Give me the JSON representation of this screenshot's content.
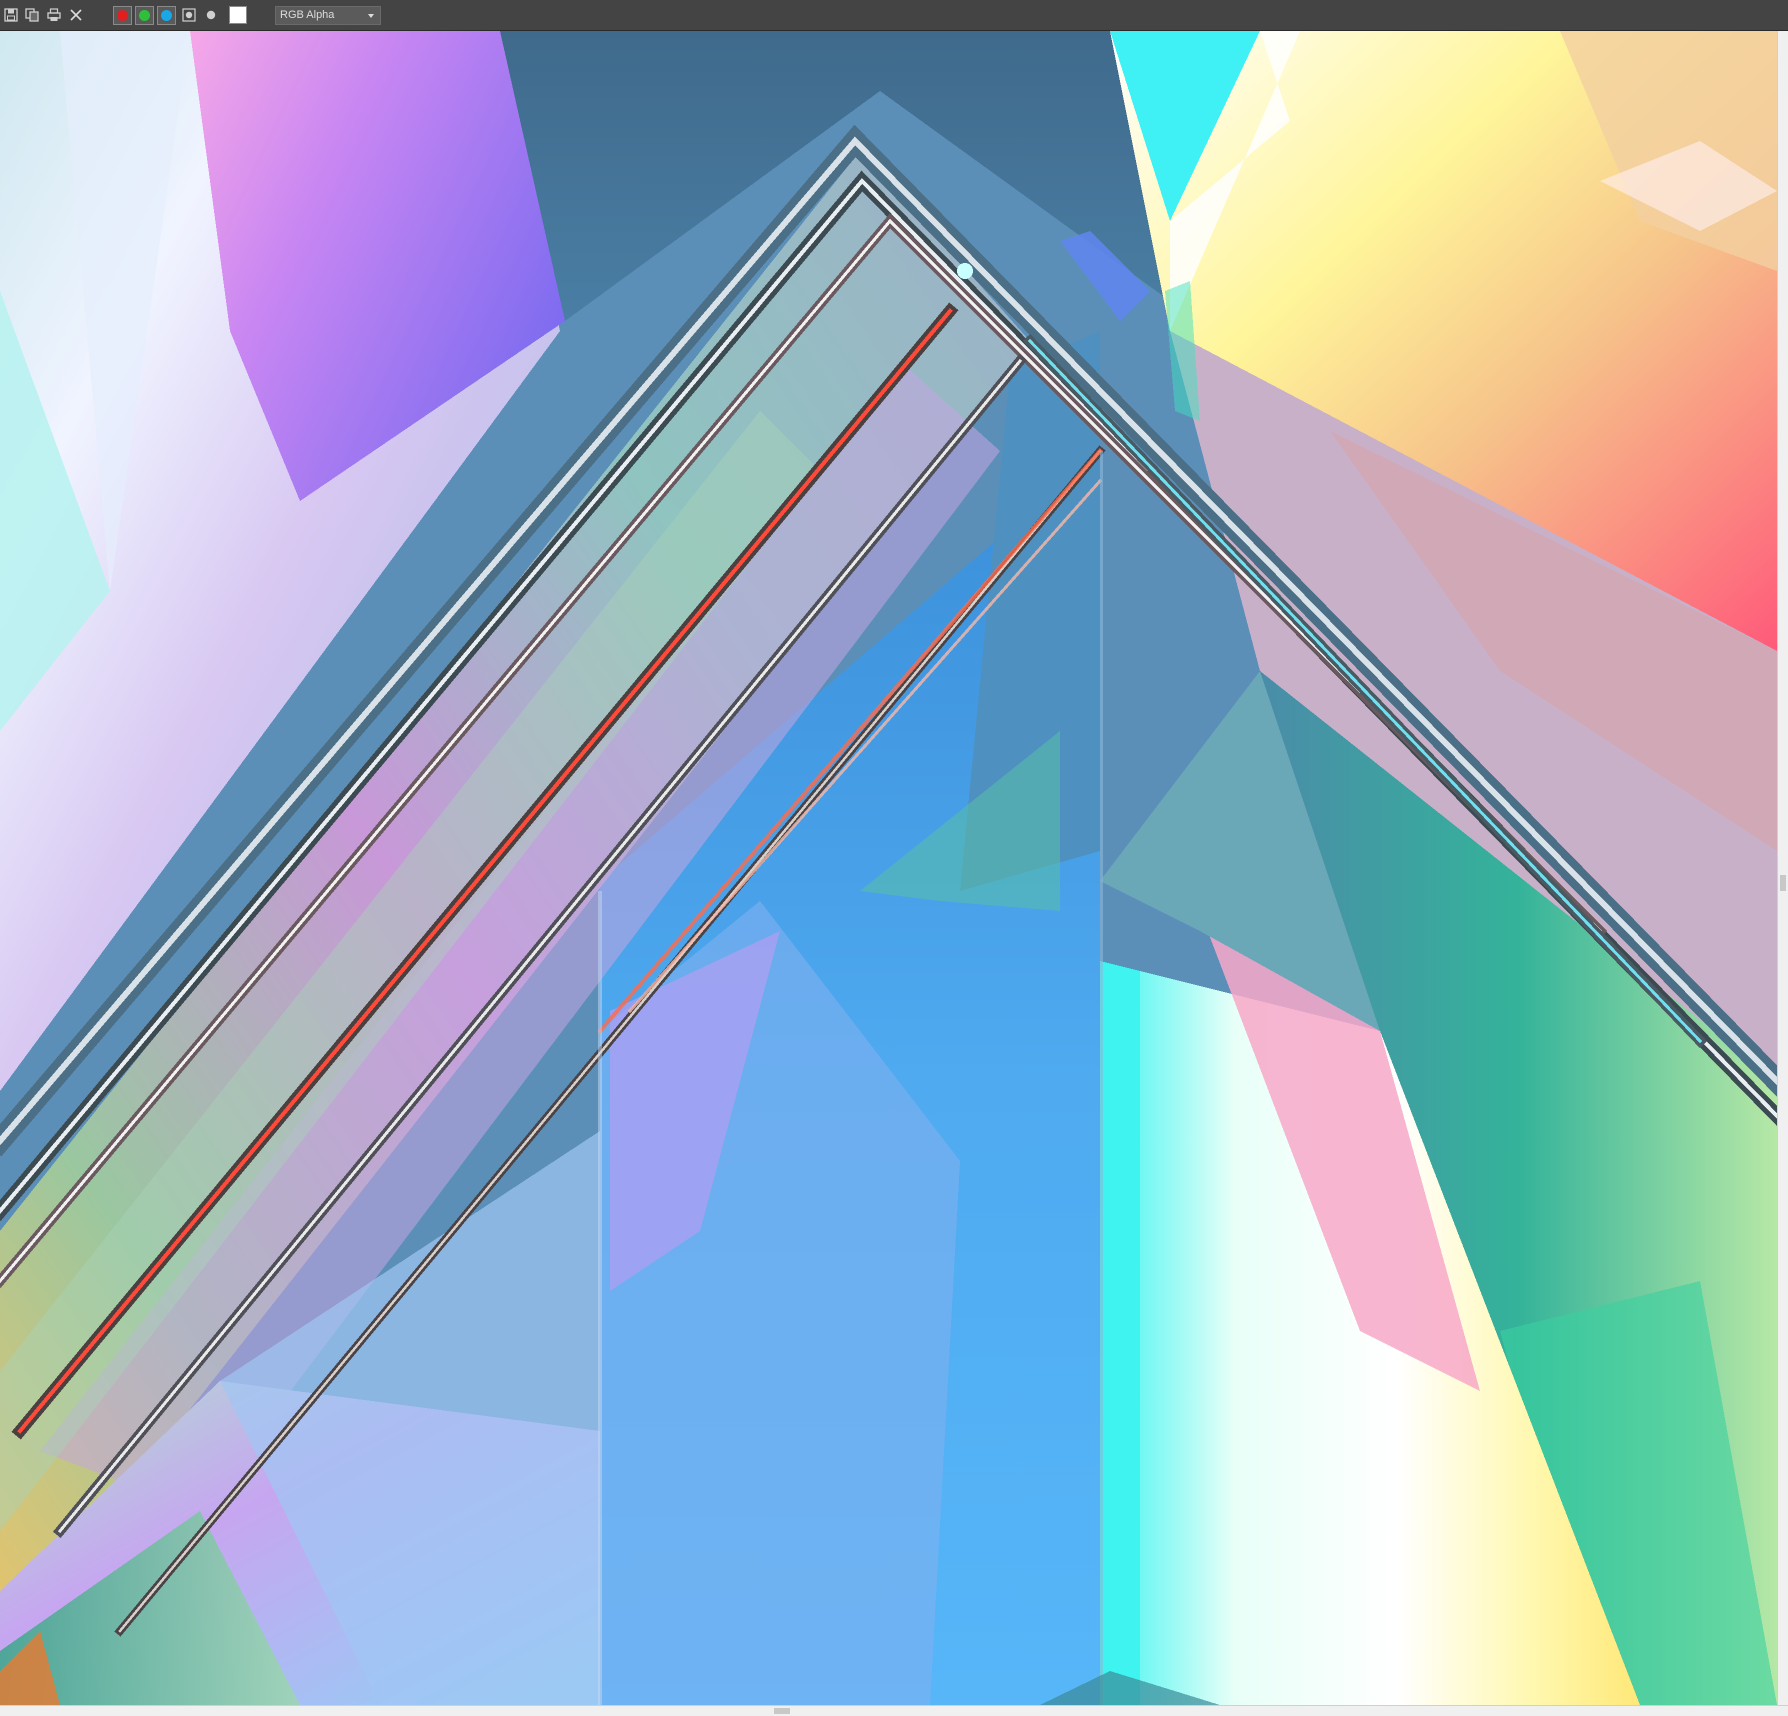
{
  "toolbar": {
    "icons": [
      "save-icon",
      "copy-icon",
      "print-icon",
      "close-icon"
    ],
    "channels": {
      "red": "#e02020",
      "green": "#2fbf3a",
      "blue": "#1aa7e6",
      "monochrome_label": "mono",
      "background_color": "#ffffff"
    },
    "display_channel": "RGB Alpha"
  },
  "render": {
    "palette": {
      "base": "#5b8fb8",
      "steel": "#3f6a8c",
      "violet": "#9a6df0",
      "pink": "#f3a6d8",
      "cyan": "#3ff4f0",
      "sky": "#4fb0f5",
      "yellow": "#ffe878",
      "white": "#ffffff",
      "teal": "#2fa890",
      "red": "#ff3a2a"
    }
  }
}
